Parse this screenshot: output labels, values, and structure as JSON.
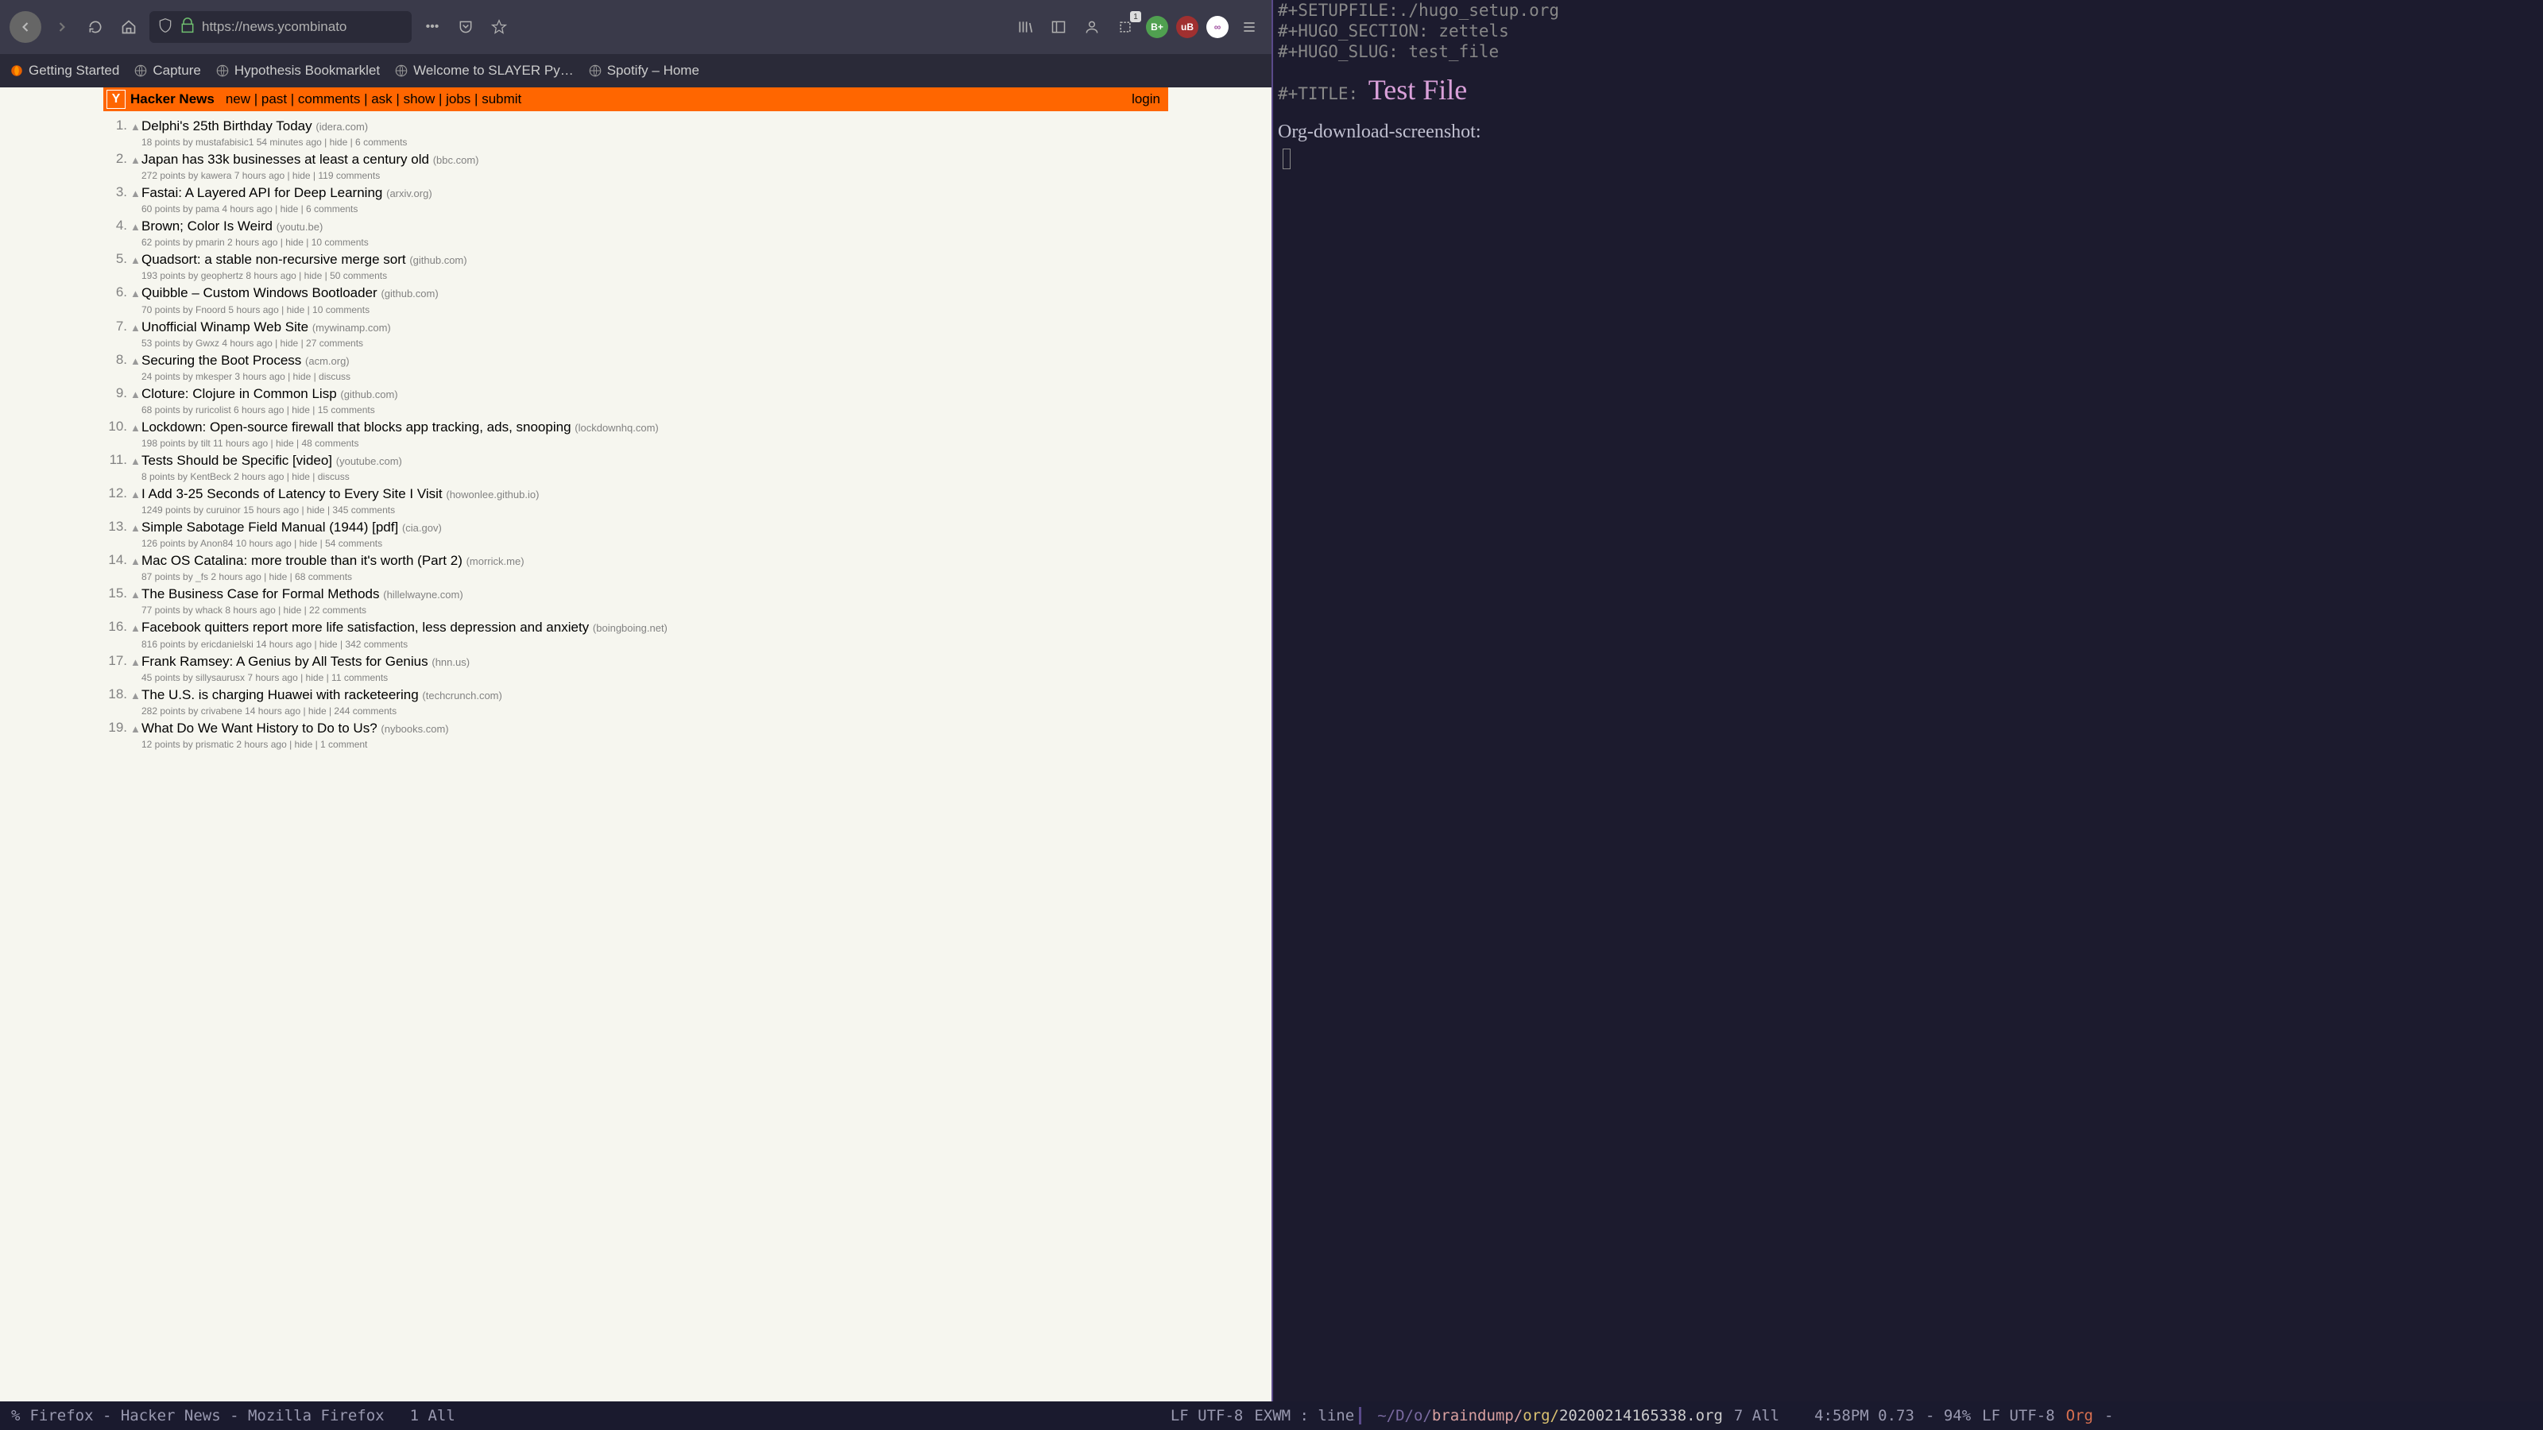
{
  "firefox": {
    "url": "https://news.ycombinato",
    "counter": "1",
    "bookmarks": [
      "Getting Started",
      "Capture",
      "Hypothesis Bookmarklet",
      "Welcome to SLAYER Py…",
      "Spotify – Home"
    ]
  },
  "hn": {
    "brand": "Hacker News",
    "nav": [
      "new",
      "past",
      "comments",
      "ask",
      "show",
      "jobs",
      "submit"
    ],
    "login": "login",
    "items": [
      {
        "rank": "1.",
        "title": "Delphi's 25th Birthday Today",
        "site": "(idera.com)",
        "sub": "18 points by mustafabisic1 54 minutes ago | hide | 6 comments"
      },
      {
        "rank": "2.",
        "title": "Japan has 33k businesses at least a century old",
        "site": "(bbc.com)",
        "sub": "272 points by kawera 7 hours ago | hide | 119 comments"
      },
      {
        "rank": "3.",
        "title": "Fastai: A Layered API for Deep Learning",
        "site": "(arxiv.org)",
        "sub": "60 points by pama 4 hours ago | hide | 6 comments"
      },
      {
        "rank": "4.",
        "title": "Brown; Color Is Weird",
        "site": "(youtu.be)",
        "sub": "62 points by pmarin 2 hours ago | hide | 10 comments"
      },
      {
        "rank": "5.",
        "title": "Quadsort: a stable non-recursive merge sort",
        "site": "(github.com)",
        "sub": "193 points by geophertz 8 hours ago | hide | 50 comments"
      },
      {
        "rank": "6.",
        "title": "Quibble – Custom Windows Bootloader",
        "site": "(github.com)",
        "sub": "70 points by Fnoord 5 hours ago | hide | 10 comments"
      },
      {
        "rank": "7.",
        "title": "Unofficial Winamp Web Site",
        "site": "(mywinamp.com)",
        "sub": "53 points by Gwxz 4 hours ago | hide | 27 comments"
      },
      {
        "rank": "8.",
        "title": "Securing the Boot Process",
        "site": "(acm.org)",
        "sub": "24 points by mkesper 3 hours ago | hide | discuss"
      },
      {
        "rank": "9.",
        "title": "Cloture: Clojure in Common Lisp",
        "site": "(github.com)",
        "sub": "68 points by ruricolist 6 hours ago | hide | 15 comments"
      },
      {
        "rank": "10.",
        "title": "Lockdown: Open-source firewall that blocks app tracking, ads, snooping",
        "site": "(lockdownhq.com)",
        "sub": "198 points by tilt 11 hours ago | hide | 48 comments"
      },
      {
        "rank": "11.",
        "title": "Tests Should be Specific [video]",
        "site": "(youtube.com)",
        "sub": "8 points by KentBeck 2 hours ago | hide | discuss"
      },
      {
        "rank": "12.",
        "title": "I Add 3-25 Seconds of Latency to Every Site I Visit",
        "site": "(howonlee.github.io)",
        "sub": "1249 points by curuinor 15 hours ago | hide | 345 comments"
      },
      {
        "rank": "13.",
        "title": "Simple Sabotage Field Manual (1944) [pdf]",
        "site": "(cia.gov)",
        "sub": "126 points by Anon84 10 hours ago | hide | 54 comments"
      },
      {
        "rank": "14.",
        "title": "Mac OS Catalina: more trouble than it's worth (Part 2)",
        "site": "(morrick.me)",
        "sub": "87 points by _fs 2 hours ago | hide | 68 comments"
      },
      {
        "rank": "15.",
        "title": "The Business Case for Formal Methods",
        "site": "(hillelwayne.com)",
        "sub": "77 points by whack 8 hours ago | hide | 22 comments"
      },
      {
        "rank": "16.",
        "title": "Facebook quitters report more life satisfaction, less depression and anxiety",
        "site": "(boingboing.net)",
        "sub": "816 points by ericdanielski 14 hours ago | hide | 342 comments"
      },
      {
        "rank": "17.",
        "title": "Frank Ramsey: A Genius by All Tests for Genius",
        "site": "(hnn.us)",
        "sub": "45 points by sillysaurusx 7 hours ago | hide | 11 comments"
      },
      {
        "rank": "18.",
        "title": "The U.S. is charging Huawei with racketeering",
        "site": "(techcrunch.com)",
        "sub": "282 points by crivabene 14 hours ago | hide | 244 comments"
      },
      {
        "rank": "19.",
        "title": "What Do We Want History to Do to Us?",
        "site": "(nybooks.com)",
        "sub": "12 points by prismatic 2 hours ago | hide | 1 comment"
      }
    ]
  },
  "org": {
    "setupfile_key": "#+SETUPFILE:",
    "setupfile_val": "./hugo_setup.org",
    "section_key": "#+HUGO_SECTION:",
    "section_val": " zettels",
    "slug_key": "#+HUGO_SLUG:",
    "slug_val": " test_file",
    "title_key": "#+TITLE: ",
    "title_val": "Test File",
    "heading": "Org-download-screenshot:"
  },
  "statusbar": {
    "left_mode": "%",
    "left_app": "Firefox - Hacker News - Mozilla Firefox",
    "left_pos": "1 All",
    "mid_enc": "LF UTF-8",
    "mid_mode": "EXWM : line",
    "path_tilde": "~/D/o/",
    "path_proj": "braindump/",
    "path_dir": "org/",
    "path_file": "20200214165338.org",
    "right_pos": "7 All",
    "time": "4:58PM 0.73",
    "battery": "- 94%",
    "right_enc": "LF UTF-8",
    "right_mode": "Org",
    "dash": "-"
  }
}
